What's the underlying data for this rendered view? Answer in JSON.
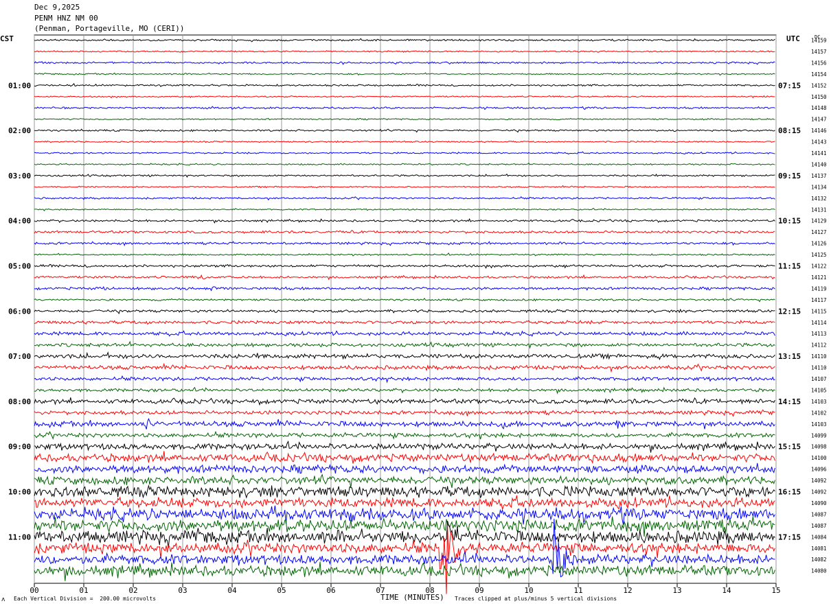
{
  "header": {
    "date": "Dec 9,2025",
    "station": "PENM HNZ NM 00",
    "location": "(Penman, Portageville, MO (CERI))"
  },
  "left_timezone": "CST",
  "right_timezone": "UTC",
  "dc_label": "DC",
  "footer": {
    "scale_note": "Each Vertical Division =  200.00 microvolts",
    "clip_note": "Traces clipped at plus/minus 5 vertical divisions",
    "x_axis_title": "TIME (MINUTES)",
    "corner_mark": "ʌ"
  },
  "chart_data": {
    "type": "line",
    "xlabel": "TIME (MINUTES)",
    "xlim": [
      0,
      15
    ],
    "x_ticks": [
      "00",
      "01",
      "02",
      "03",
      "04",
      "05",
      "06",
      "07",
      "08",
      "09",
      "10",
      "11",
      "12",
      "13",
      "14",
      "15"
    ],
    "trace_interval_minutes": 15,
    "trace_count": 48,
    "colors": [
      "#000000",
      "#ff0000",
      "#0000ff",
      "#006400"
    ],
    "left_hour_labels": [
      {
        "trace": 4,
        "label": "01:00"
      },
      {
        "trace": 8,
        "label": "02:00"
      },
      {
        "trace": 12,
        "label": "03:00"
      },
      {
        "trace": 16,
        "label": "04:00"
      },
      {
        "trace": 20,
        "label": "05:00"
      },
      {
        "trace": 24,
        "label": "06:00"
      },
      {
        "trace": 28,
        "label": "07:00"
      },
      {
        "trace": 32,
        "label": "08:00"
      },
      {
        "trace": 36,
        "label": "09:00"
      },
      {
        "trace": 40,
        "label": "10:00"
      },
      {
        "trace": 44,
        "label": "11:00"
      }
    ],
    "right_hour_labels": [
      {
        "trace": 4,
        "label": "07:15"
      },
      {
        "trace": 8,
        "label": "08:15"
      },
      {
        "trace": 12,
        "label": "09:15"
      },
      {
        "trace": 16,
        "label": "10:15"
      },
      {
        "trace": 20,
        "label": "11:15"
      },
      {
        "trace": 24,
        "label": "12:15"
      },
      {
        "trace": 28,
        "label": "13:15"
      },
      {
        "trace": 32,
        "label": "14:15"
      },
      {
        "trace": 36,
        "label": "15:15"
      },
      {
        "trace": 40,
        "label": "16:15"
      },
      {
        "trace": 44,
        "label": "17:15"
      }
    ],
    "dc_offsets": [
      "14159",
      "14157",
      "14156",
      "14154",
      "14152",
      "14150",
      "14148",
      "14147",
      "14146",
      "14143",
      "14141",
      "14140",
      "14137",
      "14134",
      "14132",
      "14131",
      "14129",
      "14127",
      "14126",
      "14125",
      "14122",
      "14121",
      "14119",
      "14117",
      "14115",
      "14114",
      "14113",
      "14112",
      "14110",
      "14110",
      "14107",
      "14105",
      "14103",
      "14102",
      "14103",
      "14099",
      "14098",
      "14100",
      "14096",
      "14092",
      "14092",
      "14090",
      "14087",
      "14087",
      "14084",
      "14081",
      "14082",
      "14080"
    ],
    "trace_noise_levels": [
      1.0,
      0.8,
      1.0,
      0.8,
      1.0,
      0.8,
      1.0,
      0.8,
      1.0,
      0.8,
      0.9,
      0.8,
      1.0,
      0.8,
      1.0,
      0.8,
      1.2,
      1.4,
      1.3,
      0.9,
      1.4,
      1.3,
      1.5,
      1.1,
      1.5,
      1.8,
      2.0,
      2.0,
      2.5,
      2.3,
      2.0,
      1.8,
      2.6,
      2.2,
      3.0,
      2.5,
      3.5,
      4.5,
      4.5,
      4.5,
      6.0,
      5.5,
      6.5,
      7.0,
      7.0,
      6.0,
      5.5,
      6.0
    ],
    "events": [
      {
        "trace": 21,
        "minute": 3.35,
        "amplitude": 4
      },
      {
        "trace": 22,
        "minute": 1.3,
        "amplitude": 4
      },
      {
        "trace": 22,
        "minute": 3.5,
        "amplitude": 3
      },
      {
        "trace": 34,
        "minute": 2.25,
        "amplitude": 8
      },
      {
        "trace": 34,
        "minute": 9.45,
        "amplitude": 12
      },
      {
        "trace": 34,
        "minute": 11.8,
        "amplitude": 8
      },
      {
        "trace": 37,
        "minute": 11.2,
        "amplitude": 10
      },
      {
        "trace": 42,
        "minute": 4.8,
        "amplitude": 14
      },
      {
        "trace": 42,
        "minute": 6.2,
        "amplitude": 16
      },
      {
        "trace": 43,
        "minute": 4.9,
        "amplitude": 14
      },
      {
        "trace": 44,
        "minute": 8.32,
        "amplitude": 40
      },
      {
        "trace": 45,
        "minute": 8.2,
        "amplitude": 40
      },
      {
        "trace": 45,
        "minute": 8.32,
        "amplitude": 60
      },
      {
        "trace": 46,
        "minute": 10.5,
        "amplitude": 60
      },
      {
        "trace": 46,
        "minute": 10.6,
        "amplitude": 28
      }
    ]
  }
}
